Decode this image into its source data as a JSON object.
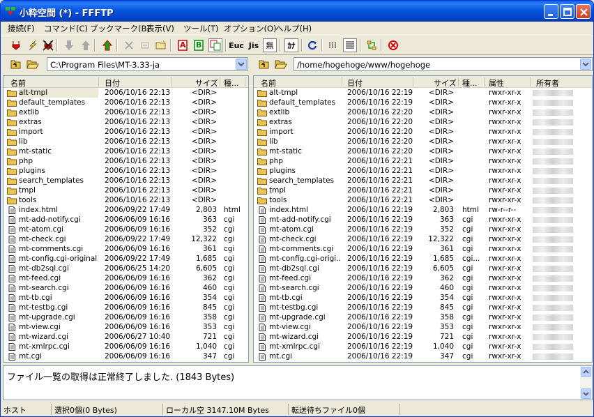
{
  "window": {
    "title": "小粋空間 (*) - FFFTP"
  },
  "menu": [
    "接続(F)",
    "コマンド(C)",
    "ブックマーク(B)",
    "表示(V)",
    "ツール(T)",
    "オプション(O)",
    "ヘルプ(H)"
  ],
  "toolbar": {
    "icons": [
      "connect-icon",
      "quick-connect-icon",
      "disconnect-icon",
      "download-icon",
      "upload-icon",
      "mirror-upload-icon",
      "delete-icon",
      "rename-icon",
      "new-folder-icon",
      "ascii-mode-icon",
      "binary-mode-icon",
      "auto-mode-icon",
      "euc-icon",
      "jis-icon",
      "no-conversion-icon",
      "kana-conversion-icon",
      "refresh-icon",
      "list-view-icon",
      "detail-view-icon",
      "sync-folder-icon",
      "abort-icon"
    ],
    "labels": {
      "ascii": "A",
      "binary": "B",
      "euc": "Euc",
      "jis": "Jis",
      "noconv": "無",
      "kana": "ｶﾅ"
    }
  },
  "local": {
    "path": "C:\\Program Files\\MT-3.33-ja",
    "columns": [
      "名前",
      "日付",
      "サイズ",
      "種..."
    ],
    "files": [
      {
        "name": "alt-tmpl",
        "date": "2006/10/16 22:13",
        "size": "<DIR>",
        "type": "",
        "dir": true
      },
      {
        "name": "default_templates",
        "date": "2006/10/16 22:13",
        "size": "<DIR>",
        "type": "",
        "dir": true
      },
      {
        "name": "extlib",
        "date": "2006/10/16 22:13",
        "size": "<DIR>",
        "type": "",
        "dir": true
      },
      {
        "name": "extras",
        "date": "2006/10/16 22:13",
        "size": "<DIR>",
        "type": "",
        "dir": true
      },
      {
        "name": "import",
        "date": "2006/10/16 22:13",
        "size": "<DIR>",
        "type": "",
        "dir": true
      },
      {
        "name": "lib",
        "date": "2006/10/16 22:13",
        "size": "<DIR>",
        "type": "",
        "dir": true
      },
      {
        "name": "mt-static",
        "date": "2006/10/16 22:13",
        "size": "<DIR>",
        "type": "",
        "dir": true
      },
      {
        "name": "php",
        "date": "2006/10/16 22:13",
        "size": "<DIR>",
        "type": "",
        "dir": true
      },
      {
        "name": "plugins",
        "date": "2006/10/16 22:13",
        "size": "<DIR>",
        "type": "",
        "dir": true
      },
      {
        "name": "search_templates",
        "date": "2006/10/16 22:13",
        "size": "<DIR>",
        "type": "",
        "dir": true
      },
      {
        "name": "tmpl",
        "date": "2006/10/16 22:13",
        "size": "<DIR>",
        "type": "",
        "dir": true
      },
      {
        "name": "tools",
        "date": "2006/10/16 22:13",
        "size": "<DIR>",
        "type": "",
        "dir": true
      },
      {
        "name": "index.html",
        "date": "2006/09/22 17:49",
        "size": "2,803",
        "type": "html",
        "dir": false
      },
      {
        "name": "mt-add-notify.cgi",
        "date": "2006/06/09 16:16",
        "size": "363",
        "type": "cgi",
        "dir": false
      },
      {
        "name": "mt-atom.cgi",
        "date": "2006/06/09 16:16",
        "size": "352",
        "type": "cgi",
        "dir": false
      },
      {
        "name": "mt-check.cgi",
        "date": "2006/09/22 17:49",
        "size": "12,322",
        "type": "cgi",
        "dir": false
      },
      {
        "name": "mt-comments.cgi",
        "date": "2006/06/09 16:16",
        "size": "361",
        "type": "cgi",
        "dir": false
      },
      {
        "name": "mt-config.cgi-original",
        "date": "2006/09/22 17:49",
        "size": "1,685",
        "type": "cgi",
        "dir": false
      },
      {
        "name": "mt-db2sql.cgi",
        "date": "2006/06/25 14:20",
        "size": "6,605",
        "type": "cgi",
        "dir": false
      },
      {
        "name": "mt-feed.cgi",
        "date": "2006/06/09 16:16",
        "size": "362",
        "type": "cgi",
        "dir": false
      },
      {
        "name": "mt-search.cgi",
        "date": "2006/06/09 16:16",
        "size": "460",
        "type": "cgi",
        "dir": false
      },
      {
        "name": "mt-tb.cgi",
        "date": "2006/06/09 16:16",
        "size": "354",
        "type": "cgi",
        "dir": false
      },
      {
        "name": "mt-testbg.cgi",
        "date": "2006/06/09 16:16",
        "size": "845",
        "type": "cgi",
        "dir": false
      },
      {
        "name": "mt-upgrade.cgi",
        "date": "2006/06/09 16:16",
        "size": "358",
        "type": "cgi",
        "dir": false
      },
      {
        "name": "mt-view.cgi",
        "date": "2006/06/09 16:16",
        "size": "353",
        "type": "cgi",
        "dir": false
      },
      {
        "name": "mt-wizard.cgi",
        "date": "2006/06/27 10:40",
        "size": "721",
        "type": "cgi",
        "dir": false
      },
      {
        "name": "mt-xmlrpc.cgi",
        "date": "2006/06/09 16:16",
        "size": "1,040",
        "type": "cgi",
        "dir": false
      },
      {
        "name": "mt.cgi",
        "date": "2006/06/09 16:16",
        "size": "347",
        "type": "cgi",
        "dir": false
      }
    ]
  },
  "remote": {
    "path": "/home/hogehoge/www/hogehoge",
    "columns": [
      "名前",
      "日付",
      "サイズ",
      "種...",
      "属性",
      "所有者"
    ],
    "files": [
      {
        "name": "alt-tmpl",
        "date": "2006/10/16 22:19",
        "size": "<DIR>",
        "type": "",
        "attr": "rwxr-xr-x",
        "dir": true
      },
      {
        "name": "default_templates",
        "date": "2006/10/16 22:19",
        "size": "<DIR>",
        "type": "",
        "attr": "rwxr-xr-x",
        "dir": true
      },
      {
        "name": "extlib",
        "date": "2006/10/16 22:20",
        "size": "<DIR>",
        "type": "",
        "attr": "rwxr-xr-x",
        "dir": true
      },
      {
        "name": "extras",
        "date": "2006/10/16 22:20",
        "size": "<DIR>",
        "type": "",
        "attr": "rwxr-xr-x",
        "dir": true
      },
      {
        "name": "import",
        "date": "2006/10/16 22:20",
        "size": "<DIR>",
        "type": "",
        "attr": "rwxr-xr-x",
        "dir": true
      },
      {
        "name": "lib",
        "date": "2006/10/16 22:20",
        "size": "<DIR>",
        "type": "",
        "attr": "rwxr-xr-x",
        "dir": true
      },
      {
        "name": "mt-static",
        "date": "2006/10/16 22:20",
        "size": "<DIR>",
        "type": "",
        "attr": "rwxr-xr-x",
        "dir": true
      },
      {
        "name": "php",
        "date": "2006/10/16 22:21",
        "size": "<DIR>",
        "type": "",
        "attr": "rwxr-xr-x",
        "dir": true
      },
      {
        "name": "plugins",
        "date": "2006/10/16 22:21",
        "size": "<DIR>",
        "type": "",
        "attr": "rwxr-xr-x",
        "dir": true
      },
      {
        "name": "search_templates",
        "date": "2006/10/16 22:21",
        "size": "<DIR>",
        "type": "",
        "attr": "rwxr-xr-x",
        "dir": true
      },
      {
        "name": "tmpl",
        "date": "2006/10/16 22:21",
        "size": "<DIR>",
        "type": "",
        "attr": "rwxr-xr-x",
        "dir": true
      },
      {
        "name": "tools",
        "date": "2006/10/16 22:21",
        "size": "<DIR>",
        "type": "",
        "attr": "rwxr-xr-x",
        "dir": true
      },
      {
        "name": "index.html",
        "date": "2006/10/16 22:19",
        "size": "2,803",
        "type": "html",
        "attr": "rw-r--r--",
        "dir": false
      },
      {
        "name": "mt-add-notify.cgi",
        "date": "2006/10/16 22:19",
        "size": "363",
        "type": "cgi",
        "attr": "rwxr-xr-x",
        "dir": false
      },
      {
        "name": "mt-atom.cgi",
        "date": "2006/10/16 22:19",
        "size": "352",
        "type": "cgi",
        "attr": "rwxr-xr-x",
        "dir": false
      },
      {
        "name": "mt-check.cgi",
        "date": "2006/10/16 22:19",
        "size": "12,322",
        "type": "cgi",
        "attr": "rwxr-xr-x",
        "dir": false
      },
      {
        "name": "mt-comments.cgi",
        "date": "2006/10/16 22:19",
        "size": "361",
        "type": "cgi",
        "attr": "rwxr-xr-x",
        "dir": false
      },
      {
        "name": "mt-config.cgi-origi...",
        "date": "2006/10/16 22:19",
        "size": "1,685",
        "type": "cgi...",
        "attr": "rwxr-xr-x",
        "dir": false
      },
      {
        "name": "mt-db2sql.cgi",
        "date": "2006/10/16 22:19",
        "size": "6,605",
        "type": "cgi",
        "attr": "rwxr-xr-x",
        "dir": false
      },
      {
        "name": "mt-feed.cgi",
        "date": "2006/10/16 22:19",
        "size": "362",
        "type": "cgi",
        "attr": "rwxr-xr-x",
        "dir": false
      },
      {
        "name": "mt-search.cgi",
        "date": "2006/10/16 22:19",
        "size": "460",
        "type": "cgi",
        "attr": "rwxr-xr-x",
        "dir": false
      },
      {
        "name": "mt-tb.cgi",
        "date": "2006/10/16 22:19",
        "size": "354",
        "type": "cgi",
        "attr": "rwxr-xr-x",
        "dir": false
      },
      {
        "name": "mt-testbg.cgi",
        "date": "2006/10/16 22:19",
        "size": "845",
        "type": "cgi",
        "attr": "rwxr-xr-x",
        "dir": false
      },
      {
        "name": "mt-upgrade.cgi",
        "date": "2006/10/16 22:19",
        "size": "358",
        "type": "cgi",
        "attr": "rwxr-xr-x",
        "dir": false
      },
      {
        "name": "mt-view.cgi",
        "date": "2006/10/16 22:19",
        "size": "353",
        "type": "cgi",
        "attr": "rwxr-xr-x",
        "dir": false
      },
      {
        "name": "mt-wizard.cgi",
        "date": "2006/10/16 22:19",
        "size": "721",
        "type": "cgi",
        "attr": "rwxr-xr-x",
        "dir": false
      },
      {
        "name": "mt-xmlrpc.cgi",
        "date": "2006/10/16 22:19",
        "size": "1,040",
        "type": "cgi",
        "attr": "rwxr-xr-x",
        "dir": false
      },
      {
        "name": "mt.cgi",
        "date": "2006/10/16 22:19",
        "size": "347",
        "type": "cgi",
        "attr": "rwxr-xr-x",
        "dir": false
      }
    ]
  },
  "log": {
    "message": "ファイル一覧の取得は正常終了しました. (1843 Bytes)"
  },
  "statusbar": {
    "host": "ホスト",
    "selection": "選択0個(0 Bytes)",
    "local_free": "ローカル空 3147.10M Bytes",
    "queue": "転送待ちファイル0個"
  },
  "colors": {
    "titlebar": "#0756e0",
    "folder": "#e9c455",
    "accent_red": "#d40000",
    "accent_green": "#18a018"
  }
}
